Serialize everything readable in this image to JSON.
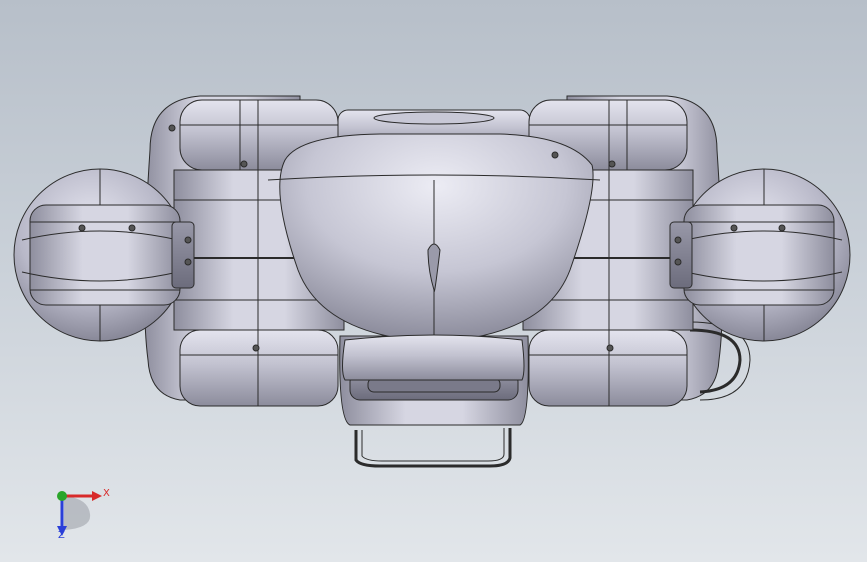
{
  "viewport": {
    "background_top": "#b7bfc9",
    "background_bottom": "#e2e6ea"
  },
  "model": {
    "shading_color": "#c4c4d2",
    "edge_color": "#2b2b2b"
  },
  "triad": {
    "x_label": "X",
    "z_label": "Z",
    "x_color": "#d82a2a",
    "y_color": "#2aa52a",
    "z_color": "#2a3fd8"
  }
}
